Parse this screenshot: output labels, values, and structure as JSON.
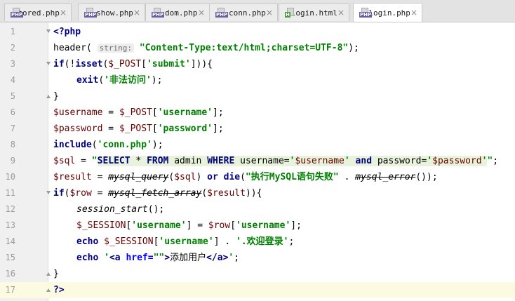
{
  "tabs": [
    {
      "name": "stored.php",
      "badge": "PHP",
      "active": false
    },
    {
      "name": "show.php",
      "badge": "PHP",
      "active": false
    },
    {
      "name": "dom.php",
      "badge": "PHP",
      "active": false
    },
    {
      "name": "conn.php",
      "badge": "PHP",
      "active": false
    },
    {
      "name": "login.html",
      "badge": "H",
      "active": false
    },
    {
      "name": "login.php",
      "badge": "PHP",
      "active": true
    }
  ],
  "close_glyph": "×",
  "current_line": 17,
  "lines": [
    {
      "n": "1",
      "indent": 0,
      "fold": "open",
      "tokens": [
        [
          "tag",
          "<?php"
        ]
      ]
    },
    {
      "n": "2",
      "indent": 0,
      "tokens": [
        [
          "fn",
          "header"
        ],
        [
          "plain",
          "( "
        ],
        [
          "hint",
          "string:"
        ],
        [
          "plain",
          " "
        ],
        [
          "str",
          "\"Content-Type:text/html;charset=UTF-8\""
        ],
        [
          "plain",
          ");"
        ]
      ]
    },
    {
      "n": "3",
      "indent": 0,
      "fold": "open",
      "tokens": [
        [
          "kw",
          "if"
        ],
        [
          "plain",
          "(!"
        ],
        [
          "kw",
          "isset"
        ],
        [
          "plain",
          "("
        ],
        [
          "var",
          "$_POST"
        ],
        [
          "plain",
          "["
        ],
        [
          "str",
          "'submit'"
        ],
        [
          "plain",
          "])){"
        ]
      ]
    },
    {
      "n": "4",
      "indent": 1,
      "tokens": [
        [
          "kw",
          "exit"
        ],
        [
          "plain",
          "("
        ],
        [
          "str",
          "'非法访问'"
        ],
        [
          "plain",
          ");"
        ]
      ]
    },
    {
      "n": "5",
      "indent": 0,
      "fold": "close",
      "tokens": [
        [
          "plain",
          "}"
        ]
      ]
    },
    {
      "n": "6",
      "indent": 0,
      "tokens": [
        [
          "var",
          "$username"
        ],
        [
          "plain",
          " = "
        ],
        [
          "var",
          "$_POST"
        ],
        [
          "plain",
          "["
        ],
        [
          "str",
          "'username'"
        ],
        [
          "plain",
          "];"
        ]
      ]
    },
    {
      "n": "7",
      "indent": 0,
      "tokens": [
        [
          "var",
          "$password"
        ],
        [
          "plain",
          " = "
        ],
        [
          "var",
          "$_POST"
        ],
        [
          "plain",
          "["
        ],
        [
          "str",
          "'password'"
        ],
        [
          "plain",
          "];"
        ]
      ]
    },
    {
      "n": "8",
      "indent": 0,
      "tokens": [
        [
          "kw",
          "include"
        ],
        [
          "plain",
          "("
        ],
        [
          "str",
          "'conn.php'"
        ],
        [
          "plain",
          ");"
        ]
      ]
    },
    {
      "n": "9",
      "indent": 0,
      "tokens": [
        [
          "var",
          "$sql"
        ],
        [
          "plain",
          " = "
        ],
        [
          "str",
          "\""
        ],
        [
          "sqlkw",
          "SELECT"
        ],
        [
          "sqlid",
          " * "
        ],
        [
          "sqlkw",
          "FROM"
        ],
        [
          "sqlid",
          " admin "
        ],
        [
          "sqlkw",
          "WHERE"
        ],
        [
          "sqlid",
          " username="
        ],
        [
          "sqlstr",
          "'"
        ],
        [
          "sqlvar",
          "$username"
        ],
        [
          "sqlstr",
          "'"
        ],
        [
          "sqlid",
          " "
        ],
        [
          "sqlkw",
          "and"
        ],
        [
          "sqlid",
          " password="
        ],
        [
          "sqlstr",
          "'"
        ],
        [
          "sqlvar",
          "$password"
        ],
        [
          "sqlstr",
          "'"
        ],
        [
          "str",
          "\""
        ],
        [
          "plain",
          ";"
        ]
      ]
    },
    {
      "n": "10",
      "indent": 0,
      "tokens": [
        [
          "var",
          "$result"
        ],
        [
          "plain",
          " = "
        ],
        [
          "dep",
          "mysql_query"
        ],
        [
          "plain",
          "("
        ],
        [
          "var",
          "$sql"
        ],
        [
          "plain",
          ") "
        ],
        [
          "kw",
          "or"
        ],
        [
          "plain",
          " "
        ],
        [
          "kw",
          "die"
        ],
        [
          "plain",
          "("
        ],
        [
          "str",
          "\"执行MySQL语句失败\""
        ],
        [
          "plain",
          " . "
        ],
        [
          "dep",
          "mysql_error"
        ],
        [
          "plain",
          "());"
        ]
      ]
    },
    {
      "n": "11",
      "indent": 0,
      "fold": "open",
      "tokens": [
        [
          "kw",
          "if"
        ],
        [
          "plain",
          "("
        ],
        [
          "var",
          "$row"
        ],
        [
          "plain",
          " = "
        ],
        [
          "dep",
          "mysql_fetch_array"
        ],
        [
          "plain",
          "("
        ],
        [
          "var",
          "$result"
        ],
        [
          "plain",
          ")){"
        ]
      ]
    },
    {
      "n": "12",
      "indent": 1,
      "tokens": [
        [
          "ital",
          "session_start"
        ],
        [
          "plain",
          "();"
        ]
      ]
    },
    {
      "n": "13",
      "indent": 1,
      "tokens": [
        [
          "var",
          "$_SESSION"
        ],
        [
          "plain",
          "["
        ],
        [
          "str",
          "'username'"
        ],
        [
          "plain",
          "] = "
        ],
        [
          "var",
          "$row"
        ],
        [
          "plain",
          "["
        ],
        [
          "str",
          "'username'"
        ],
        [
          "plain",
          "];"
        ]
      ]
    },
    {
      "n": "14",
      "indent": 1,
      "tokens": [
        [
          "kw",
          "echo"
        ],
        [
          "plain",
          " "
        ],
        [
          "var",
          "$_SESSION"
        ],
        [
          "plain",
          "["
        ],
        [
          "str",
          "'username'"
        ],
        [
          "plain",
          "] . "
        ],
        [
          "str",
          "'.欢迎登录'"
        ],
        [
          "plain",
          ";"
        ]
      ]
    },
    {
      "n": "15",
      "indent": 1,
      "tokens": [
        [
          "kw",
          "echo"
        ],
        [
          "plain",
          " "
        ],
        [
          "str",
          "'"
        ],
        [
          "htmltag",
          "<a "
        ],
        [
          "htmlattr",
          "href="
        ],
        [
          "str",
          "\"\""
        ],
        [
          "htmltag",
          ">"
        ],
        [
          "htmltext",
          "添加用户"
        ],
        [
          "htmltag",
          "</a>"
        ],
        [
          "str",
          "'"
        ],
        [
          "plain",
          ";"
        ]
      ]
    },
    {
      "n": "16",
      "indent": 0,
      "fold": "close",
      "tokens": [
        [
          "plain",
          "}"
        ]
      ]
    },
    {
      "n": "17",
      "indent": 0,
      "fold": "close",
      "tokens": [
        [
          "tag",
          "?>"
        ]
      ]
    }
  ]
}
